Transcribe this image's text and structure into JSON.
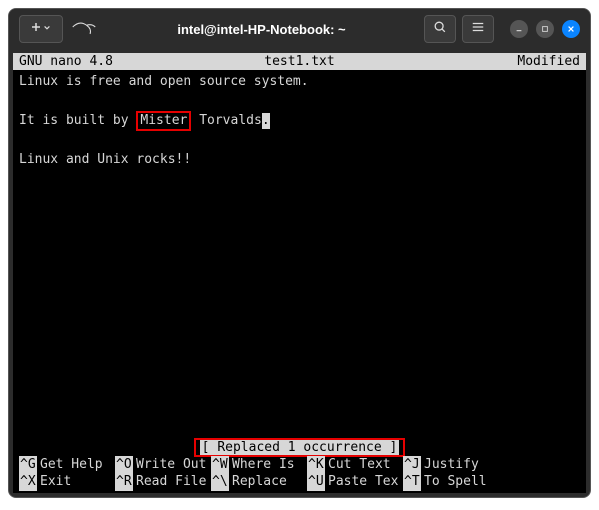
{
  "titlebar": {
    "title": "intel@intel-HP-Notebook: ~",
    "newTab": "+"
  },
  "nano": {
    "app": "GNU nano 4.8",
    "filename": "test1.txt",
    "modified": "Modified"
  },
  "content": {
    "line1": "Linux is free and open source system.",
    "line2_pre": "It is built by ",
    "line2_hl": "Mister",
    "line2_mid": " Torvalds",
    "line2_cursor": ".",
    "line3": "",
    "line4": "Linux and Unix rocks!!"
  },
  "status": {
    "message_open": "[ ",
    "message": "Replaced 1 occurrence",
    "message_close": " ]"
  },
  "shortcuts": {
    "row1": [
      {
        "key": "^G",
        "label": "Get Help"
      },
      {
        "key": "^O",
        "label": "Write Out"
      },
      {
        "key": "^W",
        "label": "Where Is"
      },
      {
        "key": "^K",
        "label": "Cut Text"
      },
      {
        "key": "^J",
        "label": "Justify"
      }
    ],
    "row2": [
      {
        "key": "^X",
        "label": "Exit"
      },
      {
        "key": "^R",
        "label": "Read File"
      },
      {
        "key": "^\\",
        "label": "Replace"
      },
      {
        "key": "^U",
        "label": "Paste Tex"
      },
      {
        "key": "^T",
        "label": "To Spell"
      }
    ]
  }
}
